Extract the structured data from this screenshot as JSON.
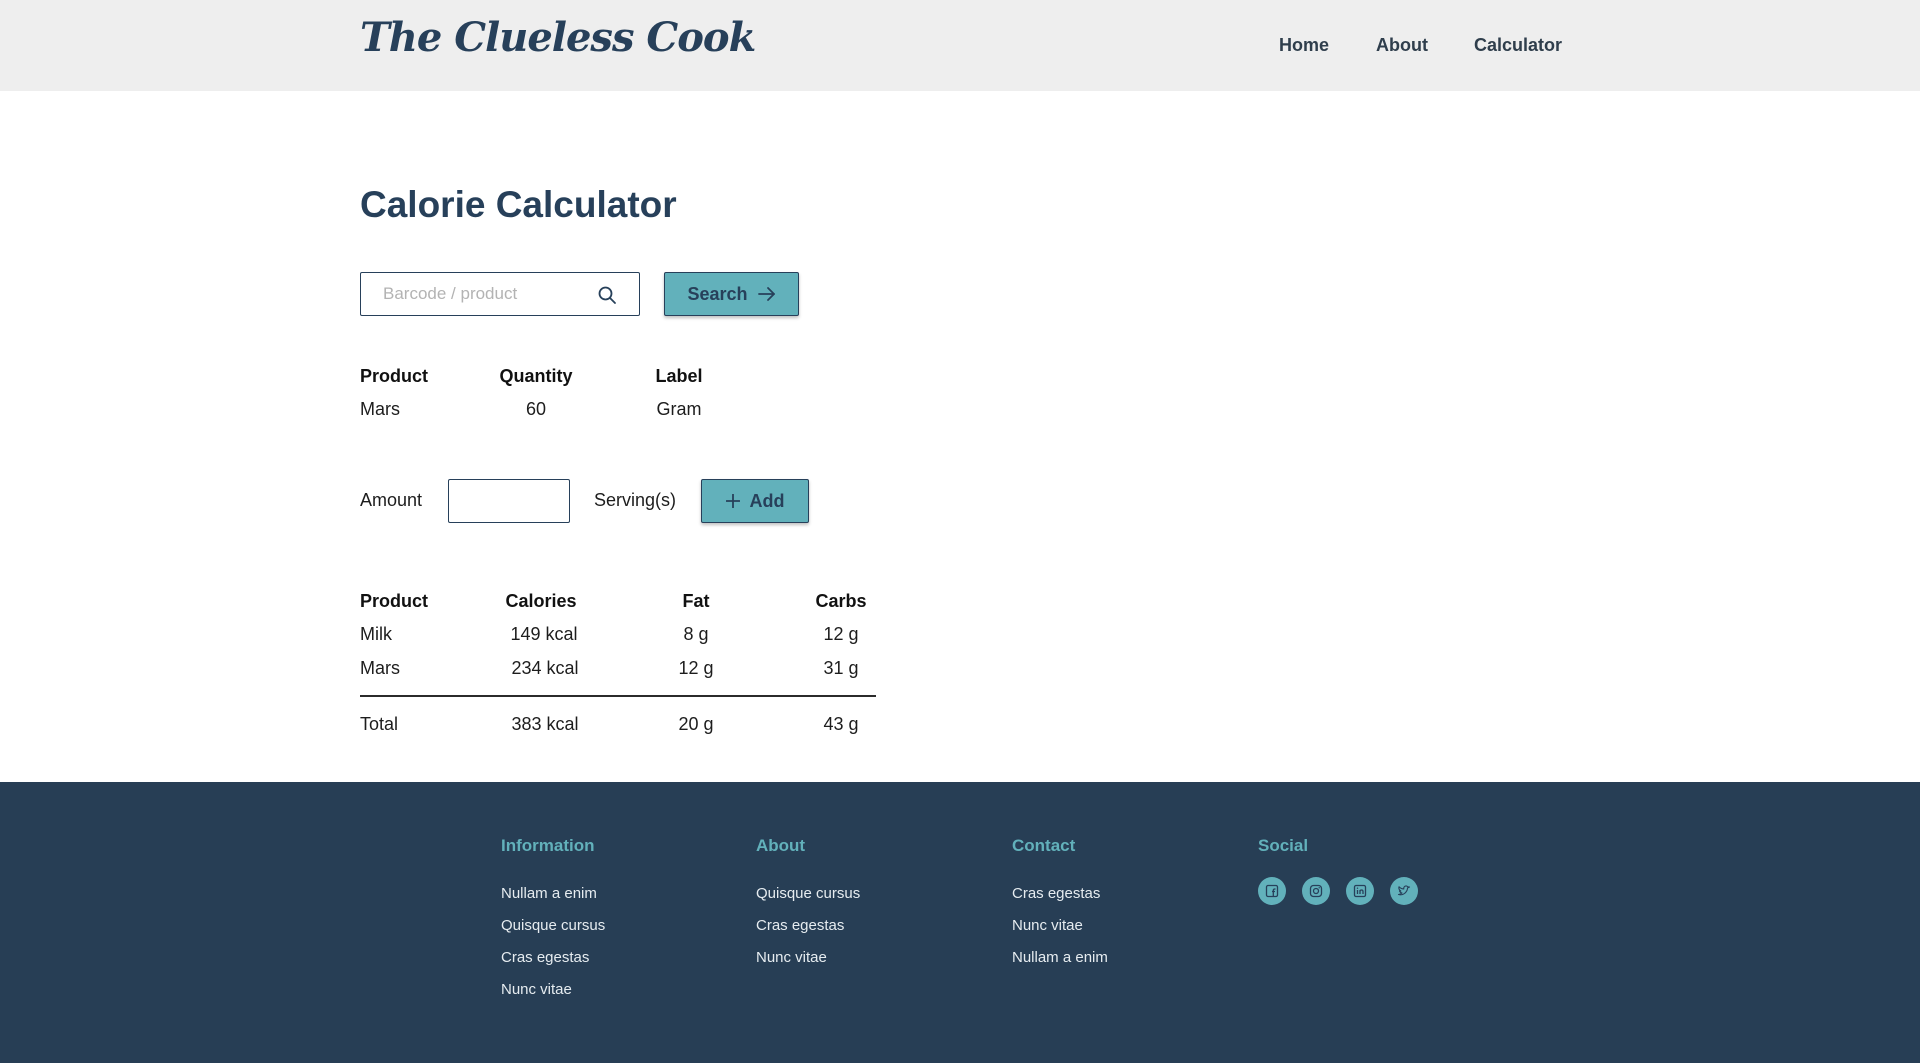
{
  "header": {
    "logo": "The Clueless Cook",
    "nav": [
      "Home",
      "About",
      "Calculator"
    ]
  },
  "main": {
    "title": "Calorie Calculator",
    "search": {
      "placeholder": "Barcode / product",
      "value": "",
      "button_label": "Search"
    },
    "product_table": {
      "headers": [
        "Product",
        "Quantity",
        "Label"
      ],
      "row": [
        "Mars",
        "60",
        "Gram"
      ]
    },
    "amount": {
      "label": "Amount",
      "value": "",
      "unit": "Serving(s)",
      "add_label": "Add"
    },
    "nutrition_table": {
      "headers": [
        "Product",
        "Calories",
        "Fat",
        "Carbs"
      ],
      "rows": [
        [
          "Milk",
          "149 kcal",
          "8 g",
          "12 g"
        ],
        [
          "Mars",
          "234 kcal",
          "12 g",
          "31 g"
        ]
      ],
      "total": [
        "Total",
        "383 kcal",
        "20 g",
        "43 g"
      ]
    }
  },
  "footer": {
    "columns": [
      {
        "title": "Information",
        "links": [
          "Nullam a enim",
          "Quisque cursus",
          "Cras egestas",
          "Nunc vitae"
        ]
      },
      {
        "title": "About",
        "links": [
          "Quisque cursus",
          "Cras egestas",
          "Nunc vitae"
        ]
      },
      {
        "title": "Contact",
        "links": [
          "Cras egestas",
          "Nunc vitae",
          "Nullam a enim"
        ]
      }
    ],
    "social": {
      "title": "Social",
      "icons": [
        "facebook-icon",
        "instagram-icon",
        "linkedin-icon",
        "twitter-icon"
      ]
    }
  },
  "colors": {
    "accent": "#62b1bb",
    "navy": "#27405a",
    "header_bg": "#eeeeee",
    "footer_bg": "#273e55"
  }
}
